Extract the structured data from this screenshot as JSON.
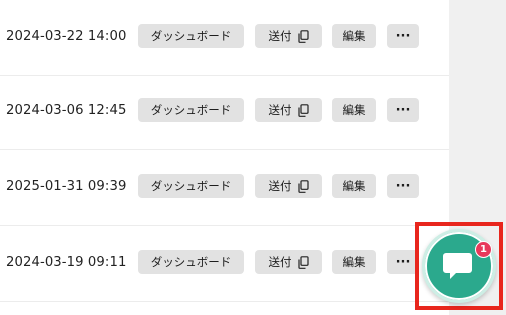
{
  "rows": [
    {
      "timestamp": "2024-03-22 14:00",
      "dashboard_label": "ダッシュボード",
      "send_label": "送付",
      "edit_label": "編集",
      "more_label": "···"
    },
    {
      "timestamp": "2024-03-06 12:45",
      "dashboard_label": "ダッシュボード",
      "send_label": "送付",
      "edit_label": "編集",
      "more_label": "···"
    },
    {
      "timestamp": "2025-01-31 09:39",
      "dashboard_label": "ダッシュボード",
      "send_label": "送付",
      "edit_label": "編集",
      "more_label": "···"
    },
    {
      "timestamp": "2024-03-19 09:11",
      "dashboard_label": "ダッシュボード",
      "send_label": "送付",
      "edit_label": "編集",
      "more_label": "···"
    }
  ],
  "chat_widget": {
    "icon": "chat-bubble-icon",
    "unread_count": "1",
    "color": "#2ba98d",
    "badge_color": "#e8395b",
    "highlight_color": "#e8261d"
  }
}
